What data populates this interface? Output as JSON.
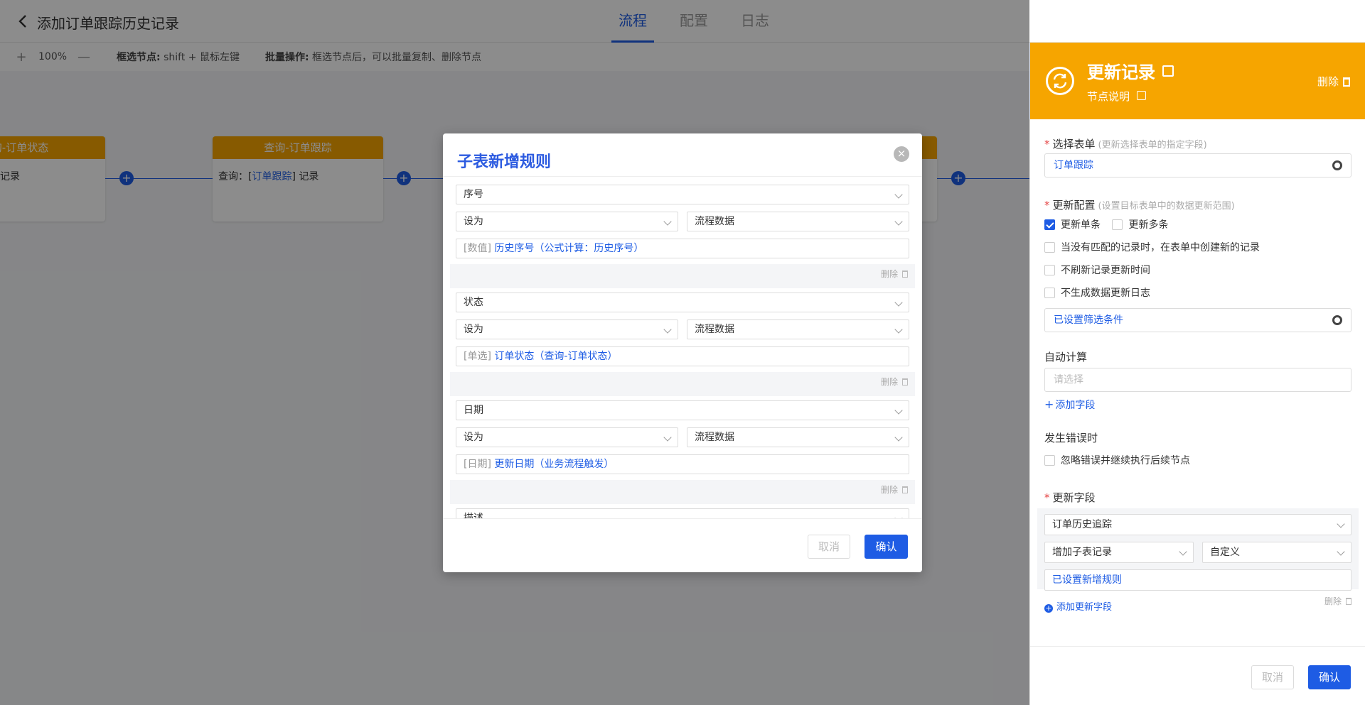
{
  "header": {
    "title": "添加订单跟踪历史记录",
    "tabs": [
      {
        "label": "流程",
        "active": true
      },
      {
        "label": "配置",
        "active": false
      },
      {
        "label": "日志",
        "active": false
      }
    ]
  },
  "toolbar": {
    "zoom_in": "+",
    "zoom": "100%",
    "zoom_out": "—",
    "box_select_label": "框选节点:",
    "box_select_text": "shift + 鼠标左键",
    "batch_label": "批量操作:",
    "batch_text": "框选节点后，可以批量复制、删除节点"
  },
  "canvas": {
    "nodes": [
      {
        "title": "询-订单状态",
        "body_text": "记录"
      },
      {
        "title": "查询-订单跟踪",
        "body_prefix": "查询：[",
        "body_link": "订单跟踪",
        "body_suffix": "] 记录"
      }
    ],
    "plus": "+"
  },
  "modal": {
    "title": "子表新增规则",
    "close": "×",
    "rules": [
      {
        "field": "序号",
        "op": "设为",
        "source": "流程数据",
        "value_prefix": "[数值]",
        "value": "历史序号（公式计算：历史序号）",
        "delete": "删除"
      },
      {
        "field": "状态",
        "op": "设为",
        "source": "流程数据",
        "value_prefix": "[单选]",
        "value": "订单状态（查询-订单状态）",
        "delete": "删除"
      },
      {
        "field": "日期",
        "op": "设为",
        "source": "流程数据",
        "value_prefix": "[日期]",
        "value": "更新日期（业务流程触发）",
        "delete": "删除"
      }
    ],
    "partial_next": "描述",
    "cancel": "取消",
    "confirm": "确认"
  },
  "panel": {
    "title": "更新记录",
    "desc": "节点说明",
    "delete": "删除",
    "select_form": {
      "label": "选择表单",
      "hint": "(更新选择表单的指定字段)",
      "value": "订单跟踪"
    },
    "update_config": {
      "label": "更新配置",
      "hint": "(设置目标表单中的数据更新范围)",
      "single": "更新单条",
      "multi": "更新多条",
      "create_when_none": "当没有匹配的记录时，在表单中创建新的记录",
      "no_refresh": "不刷新记录更新时间",
      "no_log": "不生成数据更新日志",
      "filter": "已设置筛选条件"
    },
    "auto_calc": {
      "label": "自动计算",
      "placeholder": "请选择",
      "add": "添加字段"
    },
    "on_error": {
      "label": "发生错误时",
      "ignore": "忽略错误并继续执行后续节点"
    },
    "update_fields": {
      "label": "更新字段",
      "field": "订单历史追踪",
      "action": "增加子表记录",
      "mode": "自定义",
      "rule": "已设置新增规则",
      "delete": "删除",
      "add": "添加更新字段"
    },
    "cancel": "取消",
    "confirm": "确认"
  }
}
